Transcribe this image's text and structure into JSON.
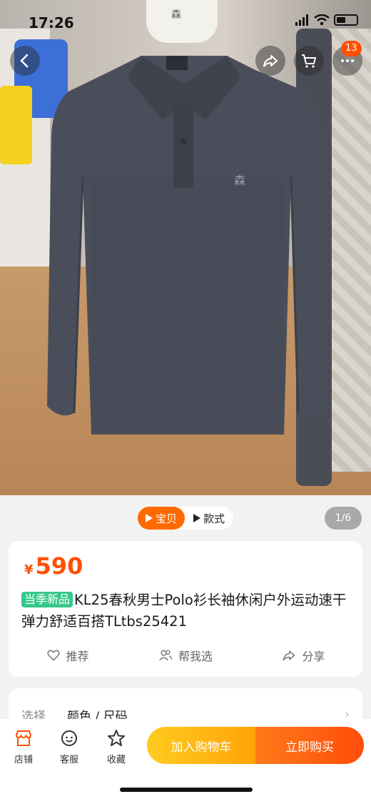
{
  "status_bar": {
    "time": "17:26"
  },
  "nav": {
    "more_badge": "13"
  },
  "gallery": {
    "tabs": [
      {
        "label": "宝贝",
        "icon": "play-icon",
        "active": true
      },
      {
        "label": "款式",
        "icon": "play-icon",
        "active": false
      }
    ],
    "page_counter": "1/6"
  },
  "product": {
    "currency": "¥",
    "price": "590",
    "badge": "当季新品",
    "title": "KL25春秋男士Polo衫长袖休闲户外运动速干弹力舒适百搭TLtbs25421",
    "actions": [
      {
        "label": "推荐",
        "icon": "heart-icon"
      },
      {
        "label": "帮我选",
        "icon": "people-icon"
      },
      {
        "label": "分享",
        "icon": "share-icon"
      }
    ]
  },
  "select": {
    "label": "选择",
    "value": "颜色 / 尺码"
  },
  "bottom_bar": {
    "items": [
      {
        "label": "店铺",
        "icon": "store-icon"
      },
      {
        "label": "客服",
        "icon": "customer-service-icon"
      },
      {
        "label": "收藏",
        "icon": "star-icon"
      }
    ],
    "add_to_cart": "加入购物车",
    "buy_now": "立即购买"
  },
  "colors": {
    "accent": "#ff5000",
    "new_badge": "#35c88a"
  }
}
